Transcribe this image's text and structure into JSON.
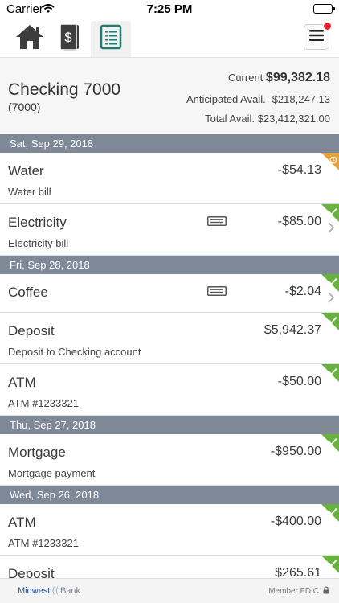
{
  "status_bar": {
    "carrier": "Carrier",
    "time": "7:25 PM"
  },
  "nav": {
    "tabs": [
      {
        "icon": "home-icon"
      },
      {
        "icon": "money-icon"
      },
      {
        "icon": "ledger-icon",
        "active": true
      }
    ],
    "menu_icon": "hamburger-icon"
  },
  "account": {
    "name": "Checking 7000",
    "number": "(7000)",
    "current_label": "Current",
    "current_value": "$99,382.18",
    "anticipated_label": "Anticipated Avail.",
    "anticipated_value": "-$218,247.13",
    "total_label": "Total Avail.",
    "total_value": "$23,412,321.00"
  },
  "dates": [
    "Sat, Sep 29, 2018",
    "Fri, Sep 28, 2018",
    "Thu, Sep 27, 2018",
    "Wed, Sep 26, 2018"
  ],
  "transactions": [
    {
      "title": "Water",
      "amount": "-$54.13",
      "desc": "Water bill",
      "status": "pending"
    },
    {
      "title": "Electricity",
      "amount": "-$85.00",
      "desc": "Electricity bill",
      "status": "cleared",
      "has_note": true
    },
    {
      "title": "Coffee",
      "amount": "-$2.04",
      "desc": "",
      "status": "cleared",
      "has_note": true
    },
    {
      "title": "Deposit",
      "amount": "$5,942.37",
      "desc": "Deposit to Checking account",
      "status": "cleared"
    },
    {
      "title": "ATM",
      "amount": "-$50.00",
      "desc": "ATM #1233321",
      "status": "cleared"
    },
    {
      "title": "Mortgage",
      "amount": "-$950.00",
      "desc": "Mortgage payment",
      "status": "cleared"
    },
    {
      "title": "ATM",
      "amount": "-$400.00",
      "desc": "ATM #1233321",
      "status": "cleared"
    },
    {
      "title": "Deposit",
      "amount": "$265.61",
      "desc": "",
      "status": "cleared"
    }
  ],
  "footer": {
    "brand_1": "Midwest",
    "brand_2": "Bank",
    "fdic": "Member FDIC"
  },
  "colors": {
    "date_header": "#7e8897",
    "cleared": "#6ab23e",
    "pending": "#e8a23a",
    "accent": "#1e7d6e"
  }
}
